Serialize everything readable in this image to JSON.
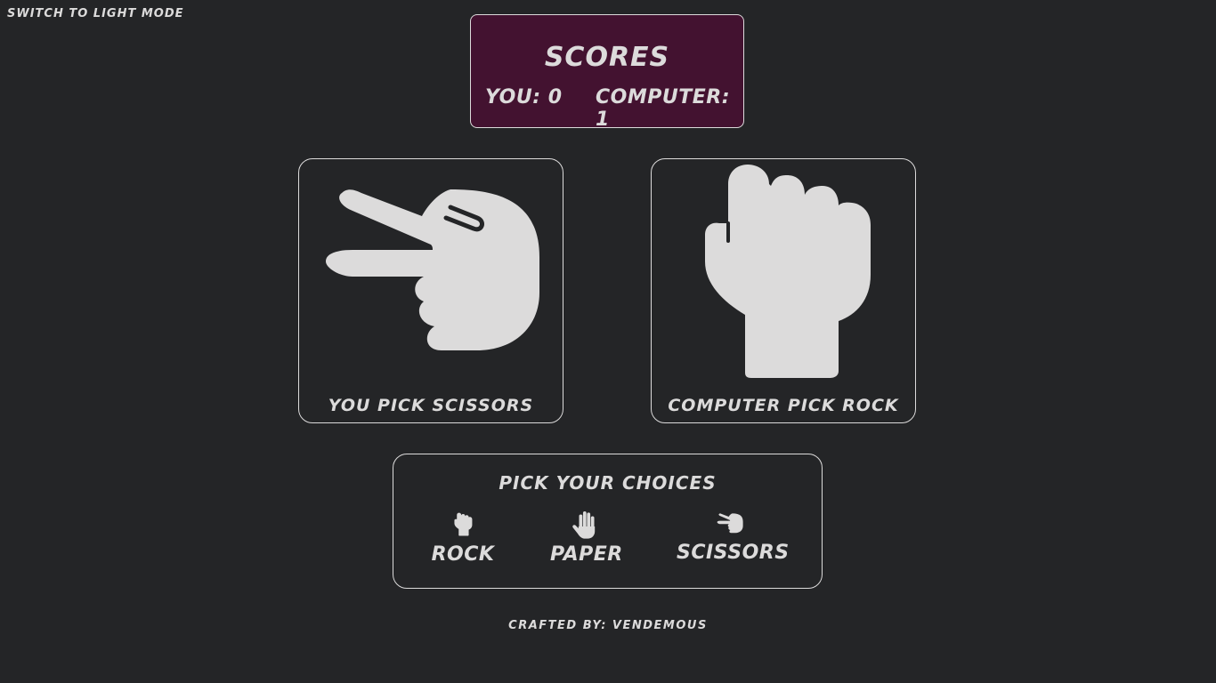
{
  "theme_toggle": {
    "label": "Switch to light mode"
  },
  "scores": {
    "title": "Scores",
    "you_label": "You:",
    "you_value": 0,
    "computer_label": "Computer:",
    "computer_value": 1
  },
  "player_pick": {
    "caption": "You Pick Scissors",
    "choice": "scissors",
    "icon": "scissors-hand-icon"
  },
  "computer_pick": {
    "caption": "Computer Pick Rock",
    "choice": "rock",
    "icon": "rock-fist-icon"
  },
  "choices": {
    "title": "Pick your choices",
    "items": [
      {
        "label": "Rock",
        "icon": "rock-fist-icon"
      },
      {
        "label": "Paper",
        "icon": "paper-hand-icon"
      },
      {
        "label": "Scissors",
        "icon": "scissors-hand-icon"
      }
    ]
  },
  "footer": {
    "text": "Crafted by: Vendemous"
  },
  "colors": {
    "background": "#242527",
    "foreground": "#dcdbdb",
    "scores_panel": "#431230"
  }
}
